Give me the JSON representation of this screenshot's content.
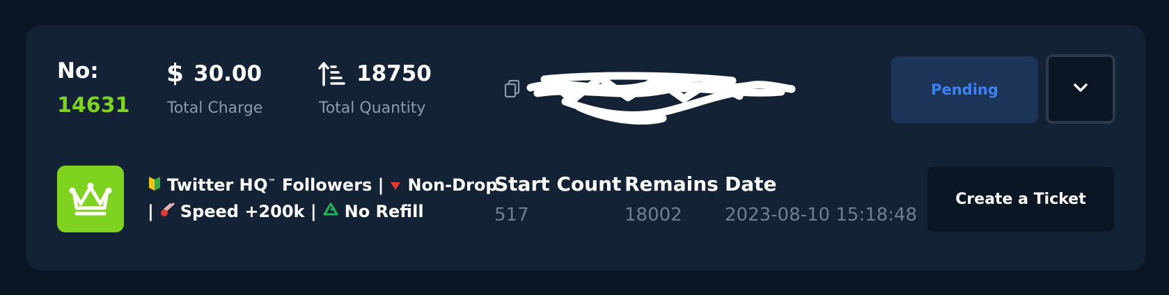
{
  "order": {
    "label": "No:",
    "number": "14631"
  },
  "charge": {
    "icon": "dollar-icon",
    "value": "30.00",
    "label": "Total Charge"
  },
  "quantity": {
    "icon": "sort-ascending-icon",
    "value": "18750",
    "label": "Total Quantity"
  },
  "status": {
    "label": "Pending",
    "color": "#3b82f6"
  },
  "service": {
    "line1_text_a": "Twitter ",
    "line1_hq": "HQ",
    "line1_tm": "™",
    "line1_text_b": " Followers |",
    "line1_text_c": "Non-Drop",
    "line2_text_a": "|",
    "line2_text_b": "Speed +200k |",
    "line2_text_c": "No Refill"
  },
  "columns": {
    "start_count": {
      "label": "Start Count",
      "value": "517"
    },
    "remains": {
      "label": "Remains",
      "value": "18002"
    },
    "date": {
      "label": "Date",
      "value": "2023-08-10 15:18:48"
    }
  },
  "ticket_button": {
    "label": "Create a Ticket"
  },
  "colors": {
    "accent_green": "#7ed321",
    "card_bg": "#132235",
    "page_bg": "#0b1625"
  }
}
